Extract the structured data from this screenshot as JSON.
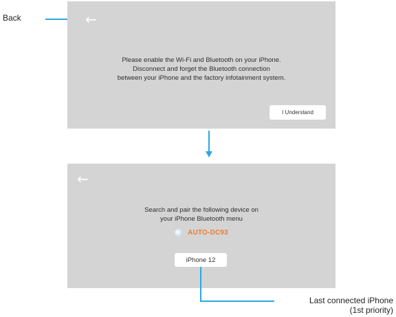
{
  "callouts": {
    "back": "Back",
    "last_connected_line1": "Last connected iPhone",
    "last_connected_line2": "(1st priority)"
  },
  "screen1": {
    "back_icon": "left-arrow-icon",
    "message_lines": [
      "Please enable the Wi-Fi and Bluetooth on your iPhone.",
      "Disconnect and forget the Bluetooth connection",
      "between your iPhone and the factory infotainment system."
    ],
    "understand_label": "I Understand"
  },
  "screen2": {
    "back_icon": "left-arrow-icon",
    "message_lines": [
      "Search and pair the following device on",
      "your  iPhone Bluetooth menu"
    ],
    "device_icon": "bluetooth-dot-icon",
    "device_name": "AUTO-DC93",
    "iphone_label": "iPhone 12"
  },
  "colors": {
    "screen_bg": "#d4d4d4",
    "accent_line": "#2aa8e0",
    "device_name": "#f07c2c"
  }
}
